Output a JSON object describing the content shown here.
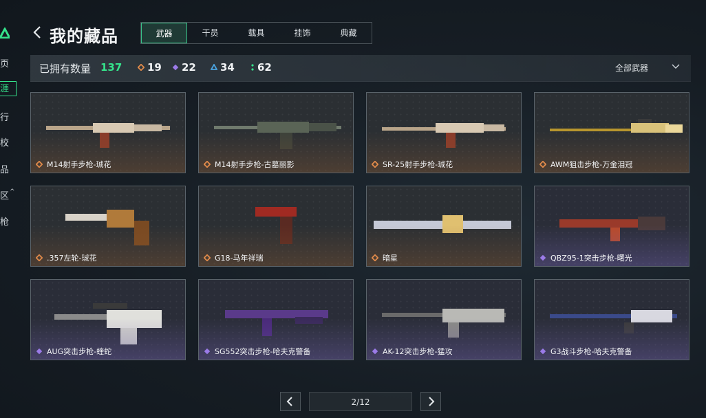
{
  "sidebar": {
    "items": [
      {
        "label": "页"
      },
      {
        "label": "涯"
      },
      {
        "label": "行"
      },
      {
        "label": "校"
      },
      {
        "label": "品"
      },
      {
        "label": "区"
      },
      {
        "label": "枪"
      }
    ]
  },
  "header": {
    "title": "我的藏品",
    "tabs": [
      {
        "label": "武器",
        "active": true
      },
      {
        "label": "干员",
        "active": false
      },
      {
        "label": "载具",
        "active": false
      },
      {
        "label": "挂饰",
        "active": false
      },
      {
        "label": "典藏",
        "active": false
      }
    ]
  },
  "stats": {
    "owned_label": "已拥有数量",
    "owned_count": "137",
    "rarities": [
      {
        "icon": "orange-diamond-icon",
        "color": "#e08a4a",
        "count": "19"
      },
      {
        "icon": "purple-diamond-icon",
        "color": "#9b7be8",
        "count": "22"
      },
      {
        "icon": "blue-triangle-icon",
        "color": "#4aa3e0",
        "count": "34"
      },
      {
        "icon": "green-dots-icon",
        "color": "#35e38b",
        "count": "62"
      }
    ],
    "filter_label": "全部武器"
  },
  "colors": {
    "accent": "#35e38b",
    "orange_rarity": "#e08a4a",
    "purple_rarity": "#9b7be8"
  },
  "items": [
    {
      "name": "M14射手步枪-珹花",
      "rarity": "orange"
    },
    {
      "name": "M14射手步枪-古墓丽影",
      "rarity": "orange"
    },
    {
      "name": "SR-25射手步枪-珹花",
      "rarity": "orange"
    },
    {
      "name": "AWM狙击步枪-万金泪冠",
      "rarity": "orange"
    },
    {
      "name": ".357左轮-珹花",
      "rarity": "orange"
    },
    {
      "name": "G18-马年祥瑞",
      "rarity": "orange"
    },
    {
      "name": "暗星",
      "rarity": "orange"
    },
    {
      "name": "QBZ95-1突击步枪-曙光",
      "rarity": "purple"
    },
    {
      "name": "AUG突击步枪-蝰蛇",
      "rarity": "purple"
    },
    {
      "name": "SG552突击步枪-哈夫克警备",
      "rarity": "purple"
    },
    {
      "name": "AK-12突击步枪-猛攻",
      "rarity": "purple"
    },
    {
      "name": "G3战斗步枪-哈夫克警备",
      "rarity": "purple"
    }
  ],
  "pagination": {
    "indicator": "2/12"
  }
}
